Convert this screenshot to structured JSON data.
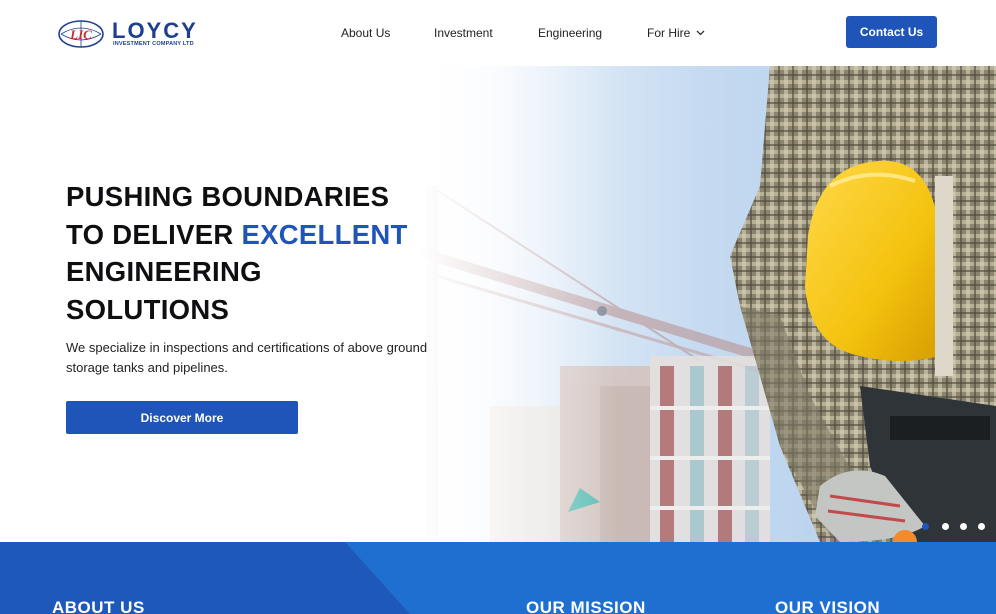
{
  "header": {
    "logo": {
      "emblem_text": "LIC",
      "word": "LOYCY",
      "sub": "INVESTMENT COMPANY LTD"
    },
    "nav": [
      {
        "label": "About Us"
      },
      {
        "label": "Investment"
      },
      {
        "label": "Engineering"
      },
      {
        "label": "For Hire",
        "icon": "chevron-down-icon"
      }
    ],
    "contact_label": "Contact Us"
  },
  "hero": {
    "title_line1": "PUSHING BOUNDARIES",
    "title_line2_prefix": "TO DELIVER ",
    "title_line2_accent": "EXCELLENT",
    "title_line3": "ENGINEERING",
    "title_line4": "SOLUTIONS",
    "description": "We specialize in inspections and certifications of above ground storage tanks and pipelines.",
    "button_label": "Discover More",
    "slider_dots": 4,
    "active_dot": 1
  },
  "band": {
    "about_heading": "ABOUT US",
    "mission_heading": "OUR MISSION",
    "vision_heading": "OUR VISION"
  },
  "colors": {
    "brand_blue": "#1f55b8",
    "logo_blue": "#1e3f8f",
    "band_blue": "#1f6fd0",
    "helmet_yellow": "#f5c518"
  }
}
